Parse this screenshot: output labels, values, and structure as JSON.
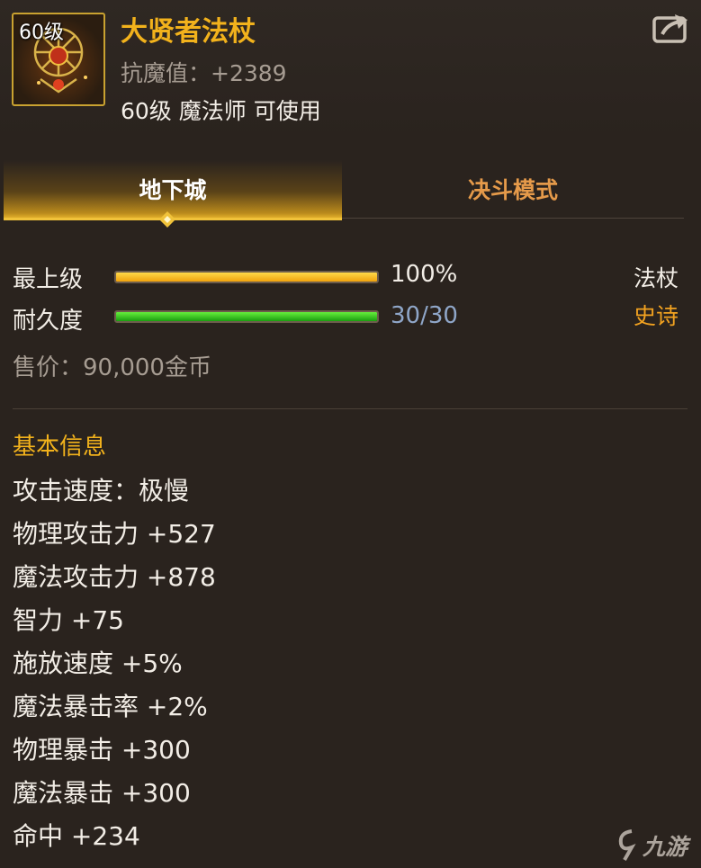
{
  "item": {
    "level_badge": "60级",
    "name": "大贤者法杖",
    "magic_resistance": "抗魔值：+2389",
    "usable_by": "60级 魔法师 可使用"
  },
  "tabs": [
    {
      "label": "地下城",
      "active": true
    },
    {
      "label": "决斗模式",
      "active": false
    }
  ],
  "stats": {
    "grade_label": "最上级",
    "grade_value": "100%",
    "grade_fraction": 1.0,
    "durability_label": "耐久度",
    "durability_value": "30/30",
    "durability_fraction": 1.0,
    "item_type": "法杖",
    "rarity": "史诗",
    "price": "售价：90,000金币"
  },
  "basic_info": {
    "title": "基本信息",
    "attributes": [
      "攻击速度：极慢",
      "物理攻击力 +527",
      "魔法攻击力 +878",
      "智力 +75",
      "施放速度 +5%",
      "魔法暴击率 +2%",
      "物理暴击 +300",
      "魔法暴击 +300",
      "命中 +234"
    ]
  },
  "watermark": {
    "text": "九游",
    "icon": "nine-game-logo-icon"
  },
  "icons": {
    "share": "share-icon",
    "item": "staff-item-icon",
    "tab_marker": "diamond-marker-icon"
  },
  "colors": {
    "item_name": "#f2b21c",
    "rarity_epic": "#f2a220",
    "durability_text": "#8fa6c8",
    "grade_bar": "#f0a20c",
    "durability_bar": "#1a9e10",
    "duel_tab": "#e59a4a"
  }
}
